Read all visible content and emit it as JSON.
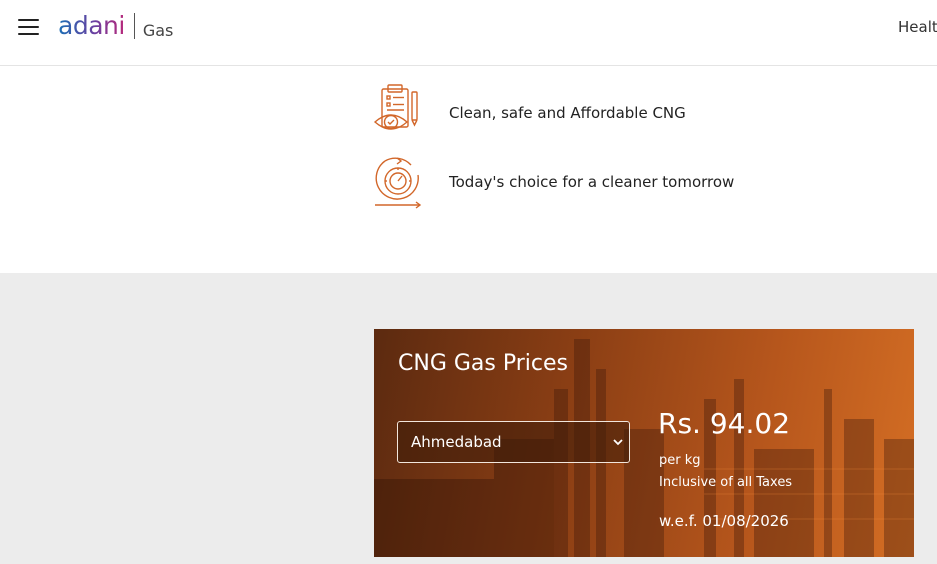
{
  "header": {
    "logo": {
      "brand": "adani",
      "sub": "Gas"
    },
    "nav": {
      "health": "Healt"
    }
  },
  "features": [
    {
      "icon": "clipboard-eye-icon",
      "label": "Clean, safe and Affordable CNG"
    },
    {
      "icon": "cycle-gauge-icon",
      "label": "Today's choice for a cleaner tomorrow"
    }
  ],
  "price_card": {
    "title": "CNG Gas Prices",
    "city_selected": "Ahmedabad",
    "price": "Rs. 94.02",
    "unit": "per kg",
    "tax_note": "Inclusive of all Taxes",
    "effective_date": "w.e.f. 01/08/2026"
  },
  "colors": {
    "accent_orange": "#d2672a",
    "card_dark": "#5c2a10",
    "band_grey": "#ececec"
  }
}
